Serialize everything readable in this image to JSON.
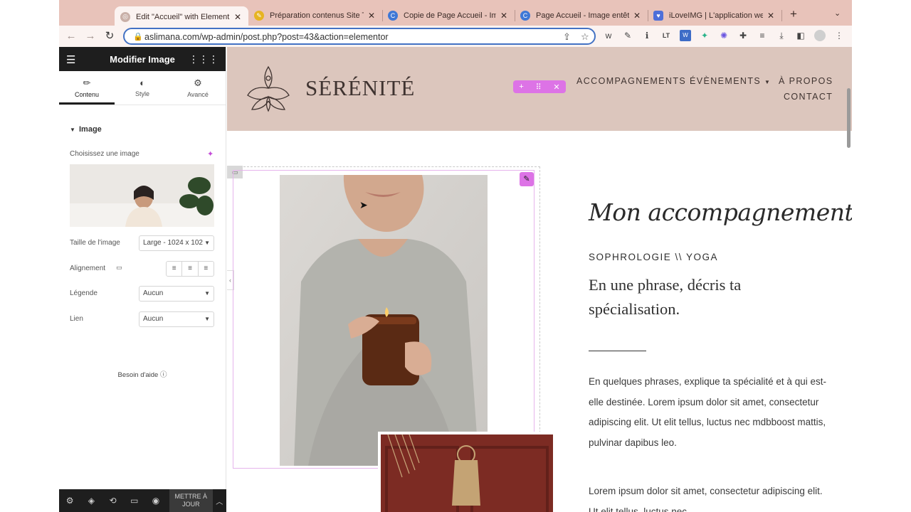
{
  "browser": {
    "tabs": [
      {
        "title": "Edit \"Accueil\" with Element",
        "active": true
      },
      {
        "title": "Préparation contenus Site T",
        "active": false
      },
      {
        "title": "Copie de Page Accueil - Ima",
        "active": false
      },
      {
        "title": "Page Accueil - Image entête",
        "active": false
      },
      {
        "title": "iLoveIMG | L'application we",
        "active": false
      }
    ],
    "close_glyph": "✕",
    "new_tab": "+",
    "tab_list": "⌄",
    "url": "aslimana.com/wp-admin/post.php?post=43&action=elementor"
  },
  "editor": {
    "panel_title": "Modifier Image",
    "tabs": {
      "content": "Contenu",
      "style": "Style",
      "advanced": "Avancé"
    },
    "section_title": "Image",
    "choose_label": "Choisissez une image",
    "size_label": "Taille de l'image",
    "size_value": "Large - 1024 x 102",
    "alignment_label": "Alignement",
    "caption_label": "Légende",
    "caption_value": "Aucun",
    "link_label": "Lien",
    "link_value": "Aucun",
    "help_text": "Besoin d'aide",
    "update_button": "METTRE À JOUR"
  },
  "site": {
    "logo_text": "SÉRÉNITÉ",
    "menu": {
      "accompagnements": "ACCOMPAGNEMENTS",
      "evenements": "ÉVÈNEMENTS",
      "a_propos": "À PROPOS",
      "contact": "CONTACT"
    },
    "script_title": "Mon accompagnement",
    "subtitle": "SOPHROLOGIE \\\\ YOGA",
    "lead": "En une phrase, décris ta spécialisation.",
    "paragraph1": "En quelques phrases, explique ta spécialité et à qui est-elle destinée. Lorem ipsum dolor sit amet, consectetur adipiscing elit. Ut elit tellus, luctus nec mdbboost mattis, pulvinar dapibus leo.",
    "paragraph2": "Lorem ipsum dolor sit amet, consectetur adipiscing elit. Ut elit tellus, luctus nec"
  },
  "colors": {
    "tabstrip": "#e8c3ba",
    "site_header": "#dcc6bd",
    "elementor_accent": "#dd73e6",
    "omnibox_border": "#4372c4"
  }
}
